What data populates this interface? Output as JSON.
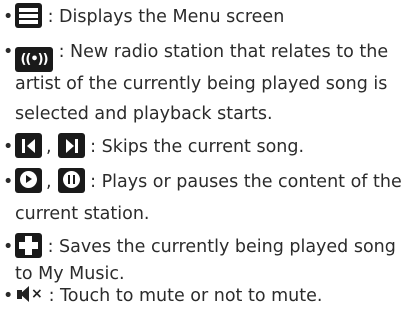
{
  "bullet": "•",
  "items": [
    {
      "icon": "menu-icon",
      "lines": [
        ": Displays the Menu screen"
      ]
    },
    {
      "icon": "radio-station-icon",
      "icon_text": "((•))",
      "lines": [
        ": New radio station that relates to the",
        "artist of the currently being played song is",
        "selected and playback starts."
      ]
    },
    {
      "icons": [
        "skip-back-icon",
        "skip-forward-icon"
      ],
      "separator": ",",
      "lines": [
        ": Skips the current song."
      ]
    },
    {
      "icons": [
        "play-icon",
        "pause-icon"
      ],
      "separator": ",",
      "lines": [
        ": Plays or pauses the content of the",
        "current station."
      ]
    },
    {
      "icon": "plus-icon",
      "lines": [
        ": Saves the currently being played song",
        "to My Music."
      ]
    },
    {
      "icon": "mute-icon",
      "lines": [
        ": Touch to mute or not to mute."
      ]
    }
  ],
  "colors": {
    "text": "#2b2b2b",
    "icon_bg": "#1a1a1a",
    "icon_fg": "#ffffff"
  }
}
